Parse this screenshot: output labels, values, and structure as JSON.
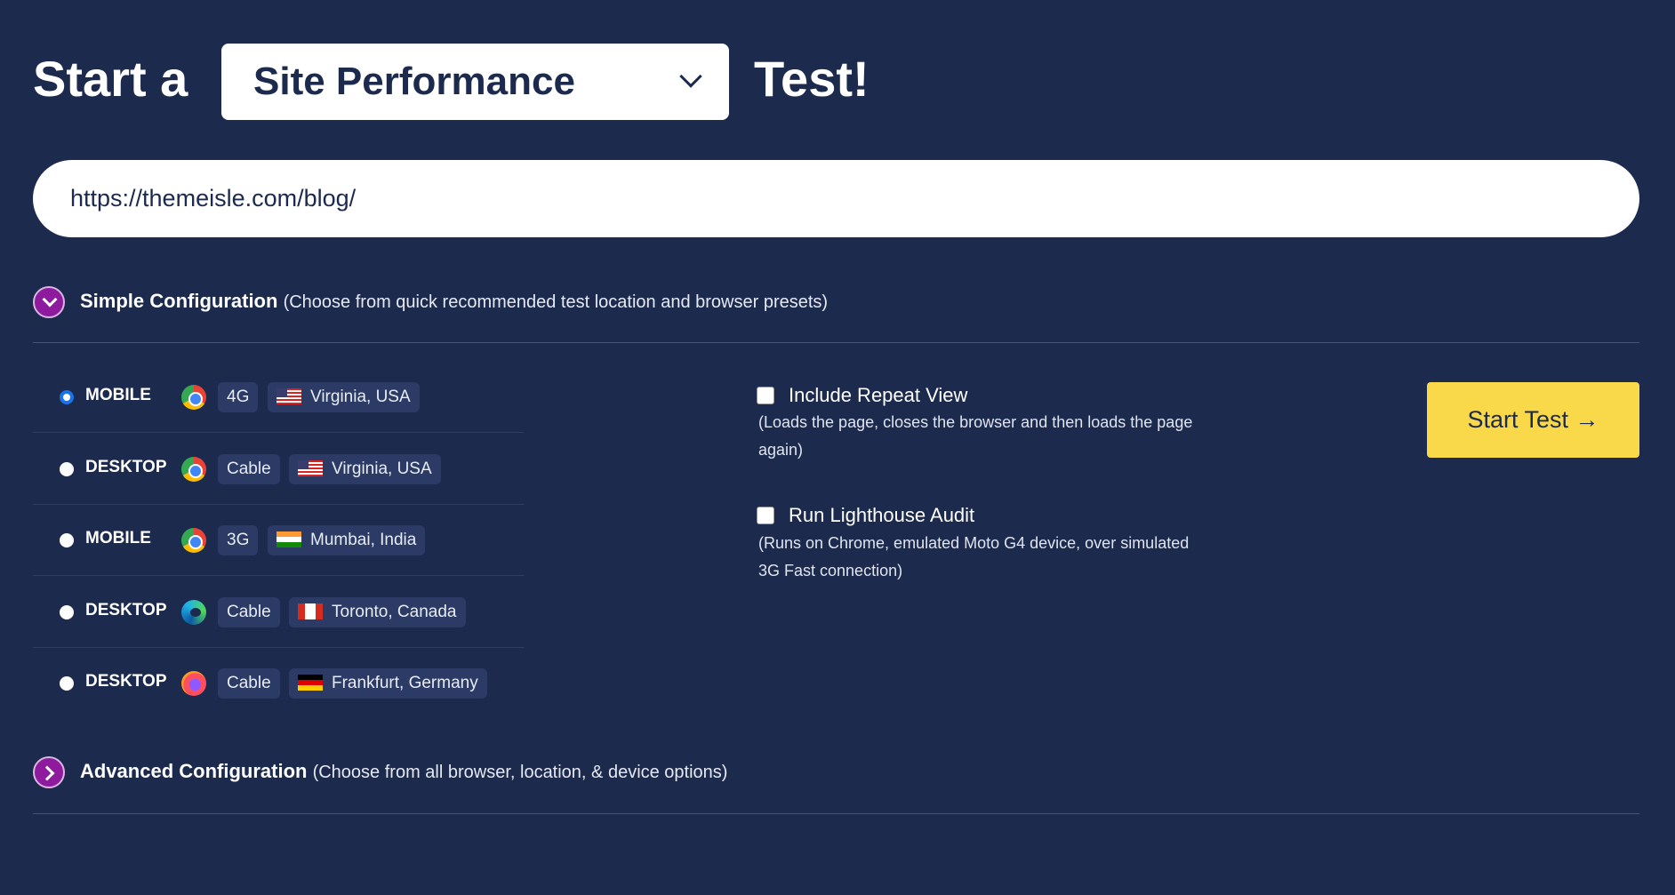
{
  "header": {
    "prefix": "Start a",
    "test_type": "Site Performance",
    "suffix": "Test!"
  },
  "url_input": {
    "value": "https://themeisle.com/blog/"
  },
  "simple_config": {
    "title": "Simple Configuration",
    "subtitle": "(Choose from quick recommended test location and browser presets)"
  },
  "presets": [
    {
      "device": "MOBILE",
      "browser": "chrome-icon",
      "connection": "4G",
      "flag": "us-flag-icon",
      "location": "Virginia, USA",
      "selected": true
    },
    {
      "device": "DESKTOP",
      "browser": "chrome-icon",
      "connection": "Cable",
      "flag": "us-flag-icon",
      "location": "Virginia, USA",
      "selected": false
    },
    {
      "device": "MOBILE",
      "browser": "chrome-icon",
      "connection": "3G",
      "flag": "india-flag-icon",
      "location": "Mumbai, India",
      "selected": false
    },
    {
      "device": "DESKTOP",
      "browser": "edge-icon",
      "connection": "Cable",
      "flag": "canada-flag-icon",
      "location": "Toronto, Canada",
      "selected": false
    },
    {
      "device": "DESKTOP",
      "browser": "firefox-icon",
      "connection": "Cable",
      "flag": "germany-flag-icon",
      "location": "Frankfurt, Germany",
      "selected": false
    }
  ],
  "options": {
    "repeat_view": {
      "label": "Include Repeat View",
      "desc": "(Loads the page, closes the browser and then loads the page again)",
      "checked": false
    },
    "lighthouse": {
      "label": "Run Lighthouse Audit",
      "desc": "(Runs on Chrome, emulated Moto G4 device, over simulated 3G Fast connection)",
      "checked": false
    }
  },
  "start_button": "Start Test →",
  "advanced_config": {
    "title": "Advanced Configuration",
    "subtitle": "(Choose from all browser, location, & device options)"
  },
  "colors": {
    "background": "#1c2a4d",
    "accent": "#8e1a9e",
    "button": "#f9d84a"
  }
}
